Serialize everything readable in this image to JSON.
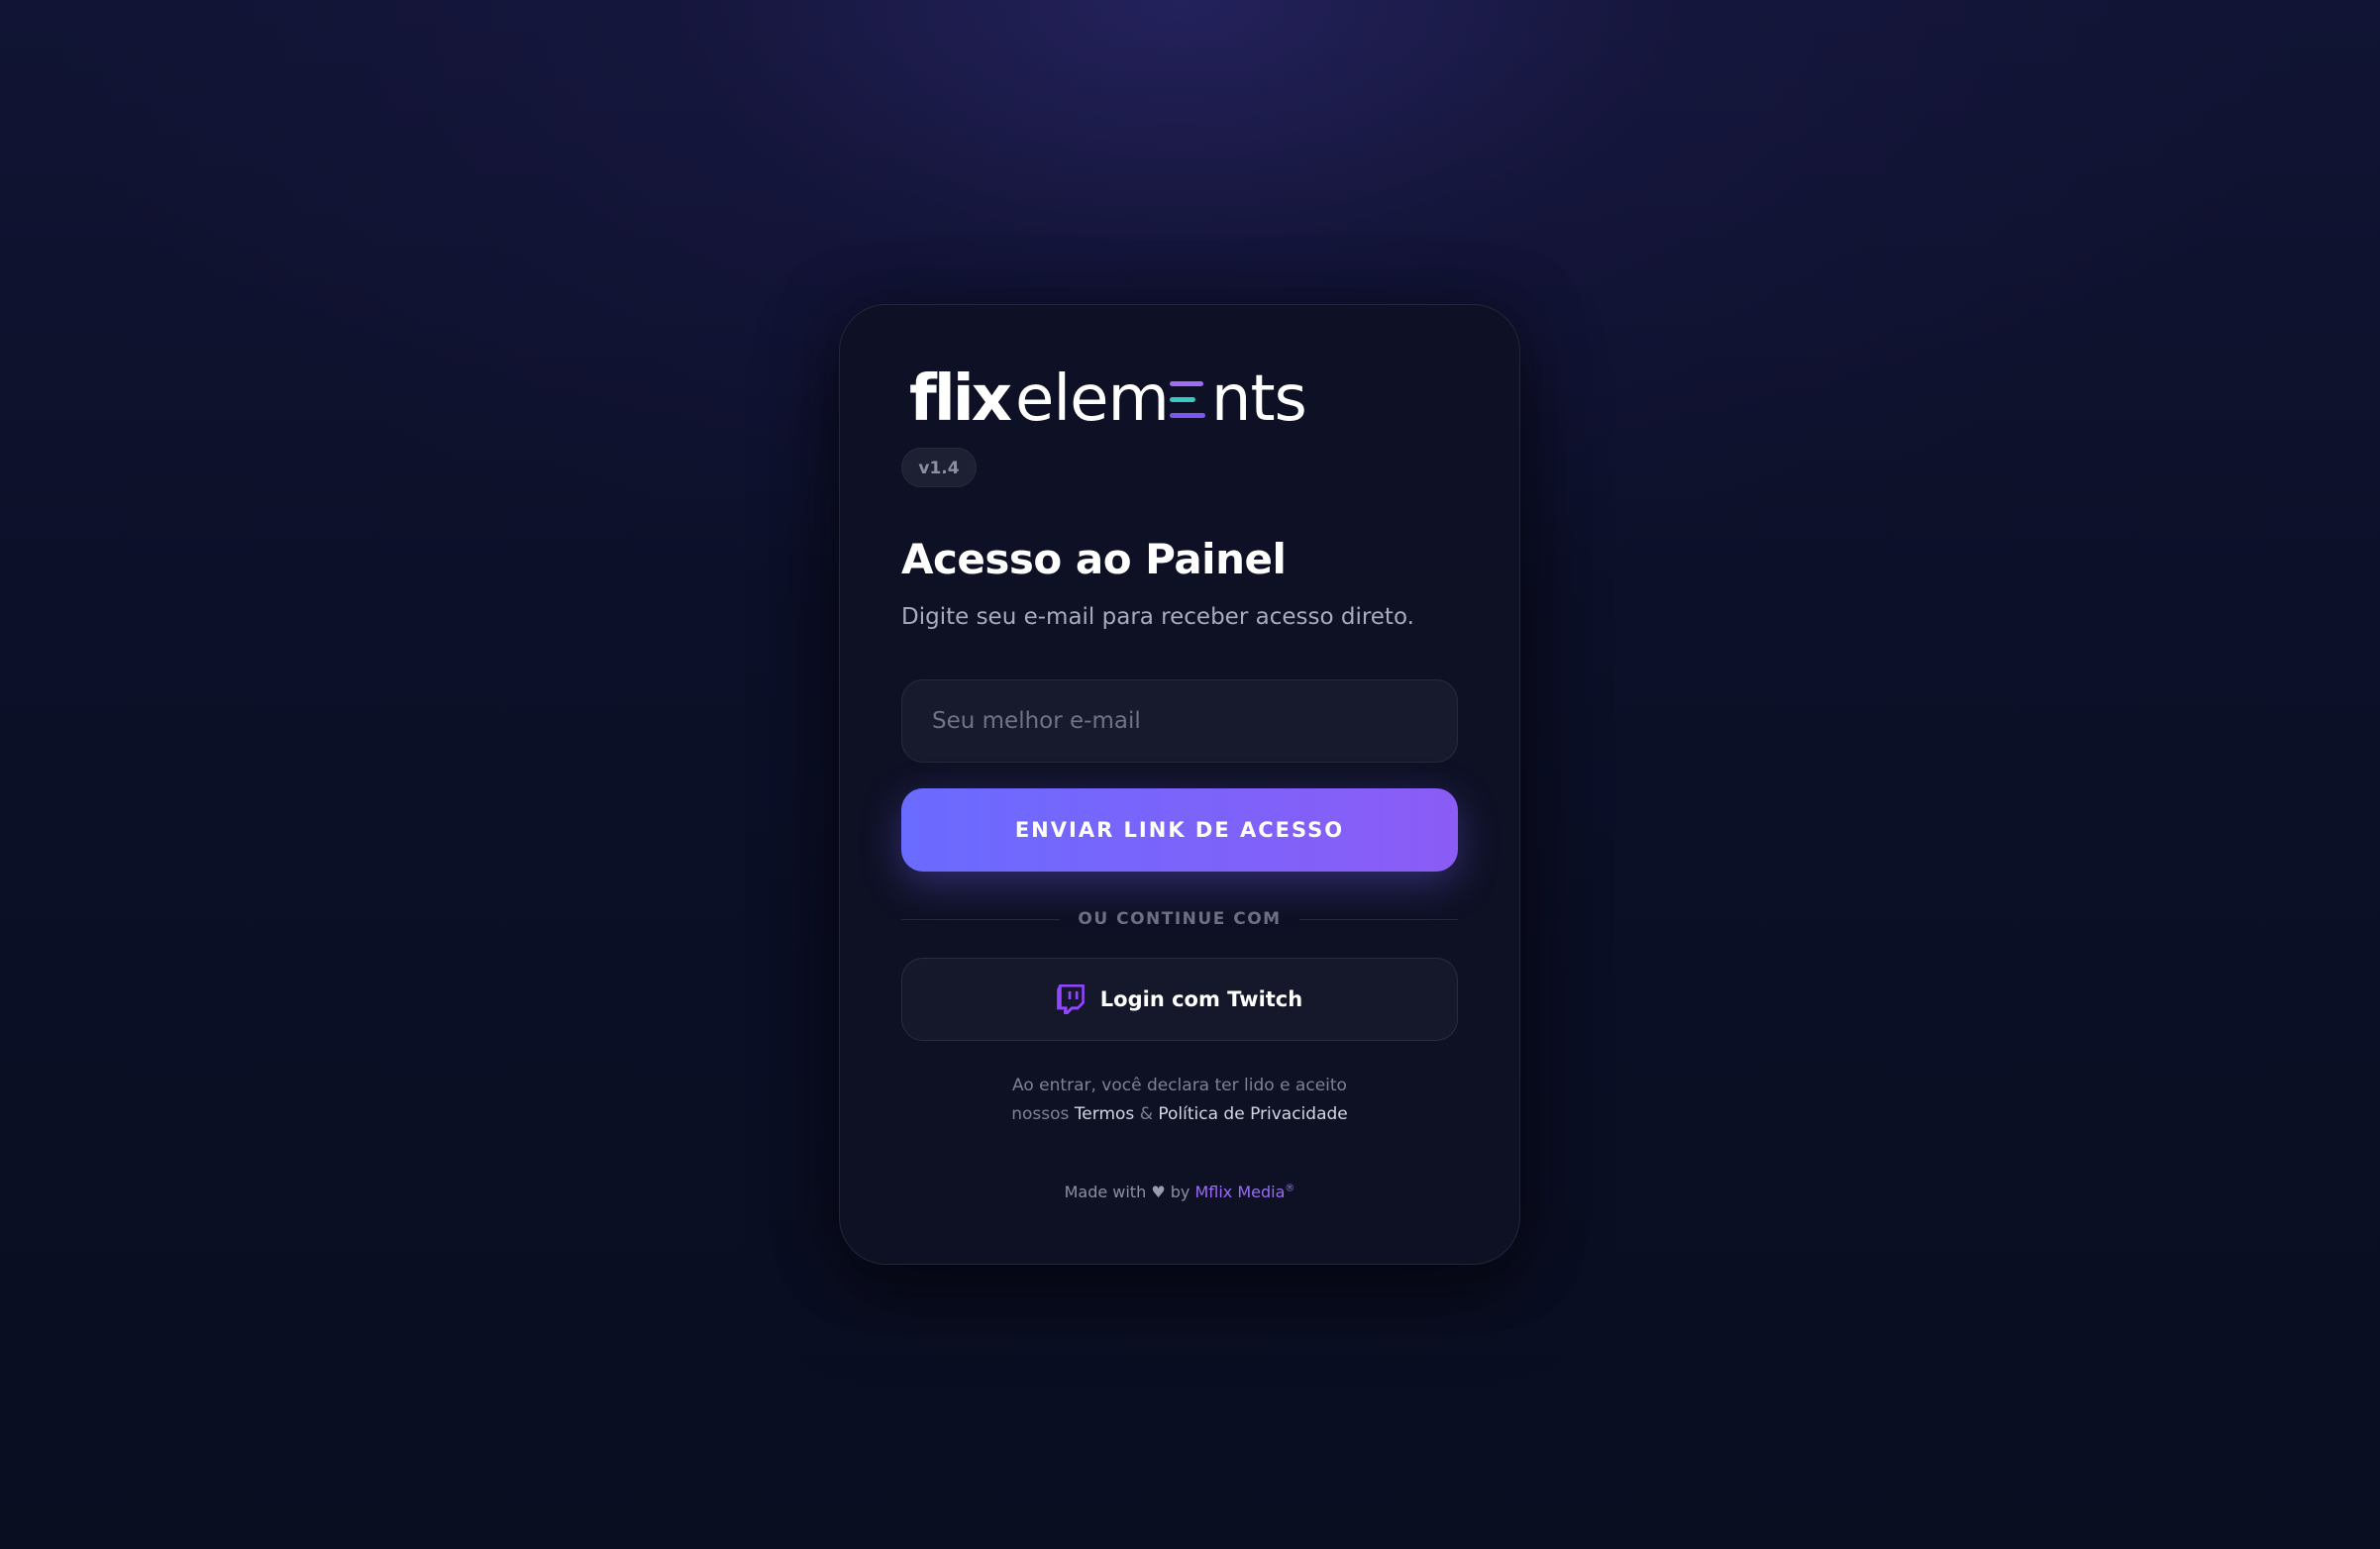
{
  "brand": {
    "logo_bold": "flix",
    "logo_light_start": "elem",
    "logo_light_end": "nts",
    "version": "v1.4",
    "colors": {
      "accent": "#8b5cf6",
      "accent_start": "#6a6bff",
      "teal": "#36c9c2",
      "background": "#0a0e21",
      "card": "#0e1125"
    }
  },
  "login": {
    "title": "Acesso ao Painel",
    "subtitle": "Digite seu e-mail para receber acesso direto.",
    "email_placeholder": "Seu melhor e-mail",
    "email_value": "",
    "submit_label": "ENVIAR LINK DE ACESSO",
    "divider_text": "OU CONTINUE COM",
    "twitch_label": "Login com Twitch",
    "twitch_icon": "twitch-icon"
  },
  "legal": {
    "line1": "Ao entrar, você declara ter lido e aceito",
    "prefix": "nossos",
    "terms_link": "Termos",
    "separator": "&",
    "privacy_link": "Política de Privacidade"
  },
  "footer": {
    "made_with": "Made with",
    "heart_icon": "heart-icon",
    "by": "by",
    "company": "Mflix Media",
    "registered": "®"
  }
}
